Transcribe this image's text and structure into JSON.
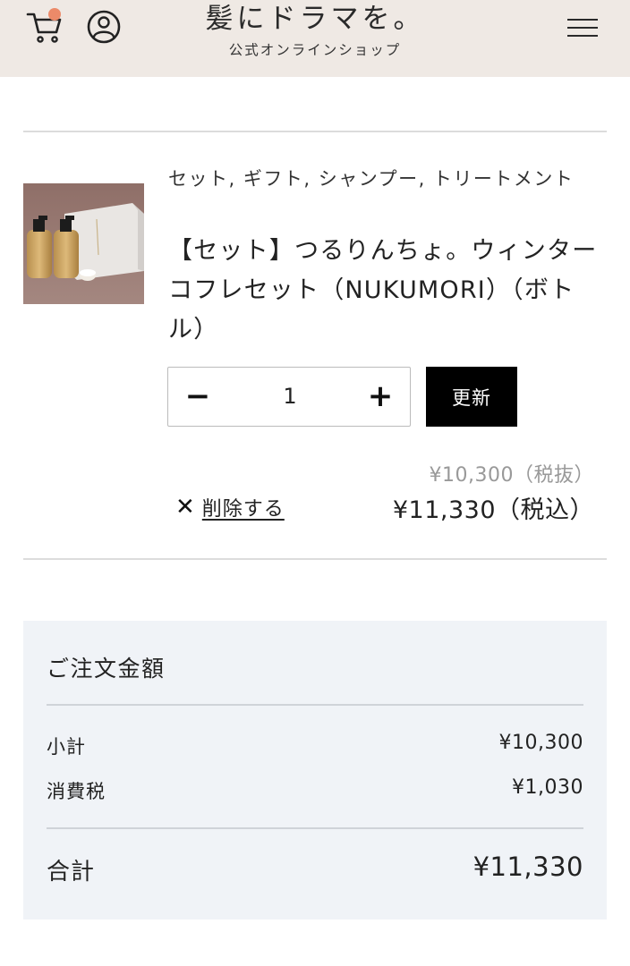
{
  "header": {
    "logo": "髪にドラマを。",
    "logo_sub": "公式オンラインショップ",
    "cart_icon": "cart-icon",
    "account_icon": "account-icon",
    "menu_icon": "hamburger-menu-icon",
    "cart_badge_color": "#ec8a69",
    "background": "#efe9e4"
  },
  "cart_item": {
    "image": "product-photo",
    "tags": "セット, ギフト, シャンプー, トリートメント",
    "name": "【セット】つるりんちょ。ウィンターコフレセット（NUKUMORI）（ボトル）",
    "quantity": "1",
    "decrease_label": "−",
    "increase_label": "+",
    "update_label": "更新",
    "delete_label": "削除する",
    "price_ex_tax": "¥10,300（税抜）",
    "price_in_tax": "¥11,330（税込）"
  },
  "summary": {
    "title": "ご注文金額",
    "subtotal_label": "小計",
    "subtotal_value": "¥10,300",
    "tax_label": "消費税",
    "tax_value": "¥1,030",
    "total_label": "合計",
    "total_value": "¥11,330",
    "background": "#f0f3f7"
  }
}
